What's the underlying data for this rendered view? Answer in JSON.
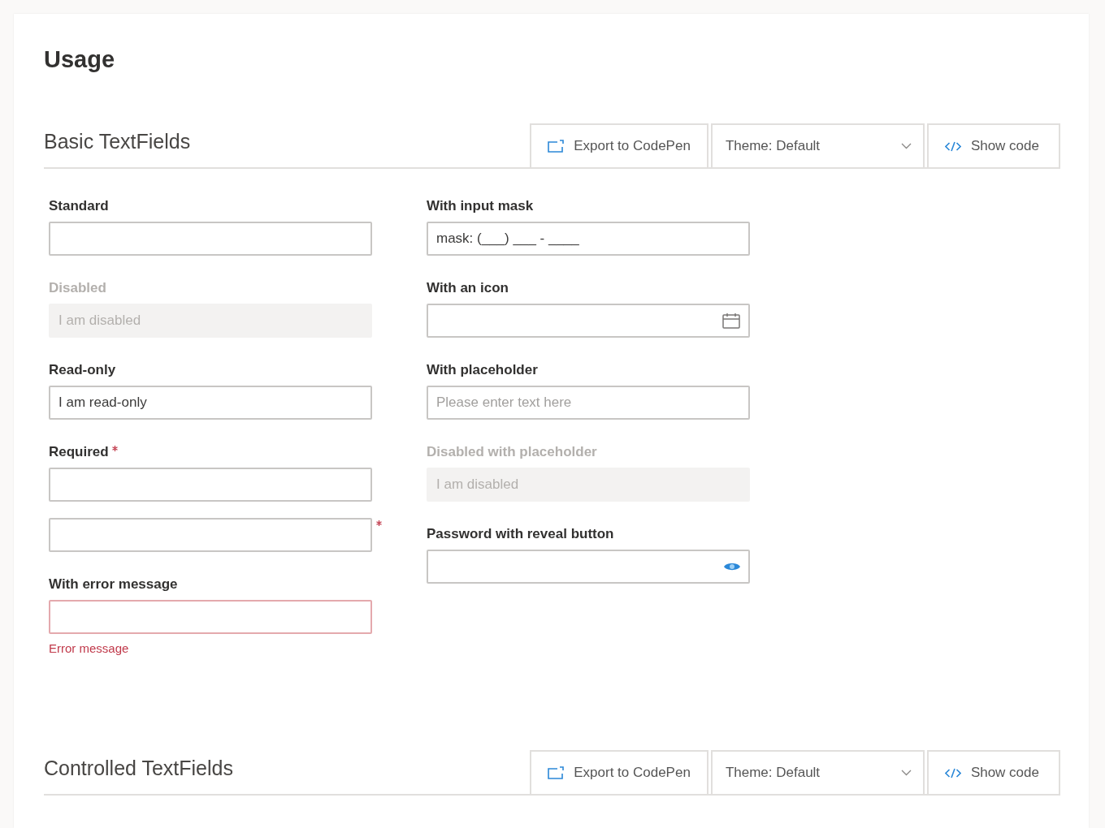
{
  "page": {
    "title": "Usage"
  },
  "sections": [
    {
      "title": "Basic TextFields",
      "toolbar": [
        {
          "kind": "export",
          "label": "Export to CodePen"
        },
        {
          "kind": "dropdown",
          "label": "Theme: Default"
        },
        {
          "kind": "code",
          "label": "Show code"
        }
      ],
      "columns": [
        {
          "fields": [
            {
              "kind": "text",
              "label": "Standard",
              "disabled": false,
              "required": false
            },
            {
              "kind": "text",
              "label": "Disabled",
              "value": "I am disabled",
              "disabled": true,
              "required": false
            },
            {
              "kind": "text",
              "label": "Read-only",
              "value": "I am read-only",
              "disabled": false,
              "required": false
            },
            {
              "kind": "text",
              "label": "Required",
              "disabled": false,
              "required": true
            },
            {
              "kind": "text",
              "disabled": false,
              "required": true
            },
            {
              "kind": "text",
              "label": "With error message",
              "disabled": false,
              "required": false,
              "error_message": "Error message"
            }
          ]
        },
        {
          "fields": [
            {
              "kind": "text",
              "label": "With input mask",
              "value": "mask: (___) ___ - ____",
              "disabled": false,
              "required": false
            },
            {
              "kind": "icon",
              "label": "With an icon",
              "disabled": false,
              "required": false
            },
            {
              "kind": "text",
              "label": "With placeholder",
              "placeholder": "Please enter text here",
              "disabled": false,
              "required": false
            },
            {
              "kind": "text",
              "label": "Disabled with placeholder",
              "placeholder": "I am disabled",
              "disabled": true,
              "required": false
            },
            {
              "kind": "password",
              "label": "Password with reveal button",
              "disabled": false,
              "required": false
            }
          ]
        }
      ]
    },
    {
      "title": "Controlled TextFields",
      "toolbar": [
        {
          "kind": "export",
          "label": "Export to CodePen"
        },
        {
          "kind": "dropdown",
          "label": "Theme: Default"
        },
        {
          "kind": "code",
          "label": "Show code"
        }
      ]
    }
  ]
}
